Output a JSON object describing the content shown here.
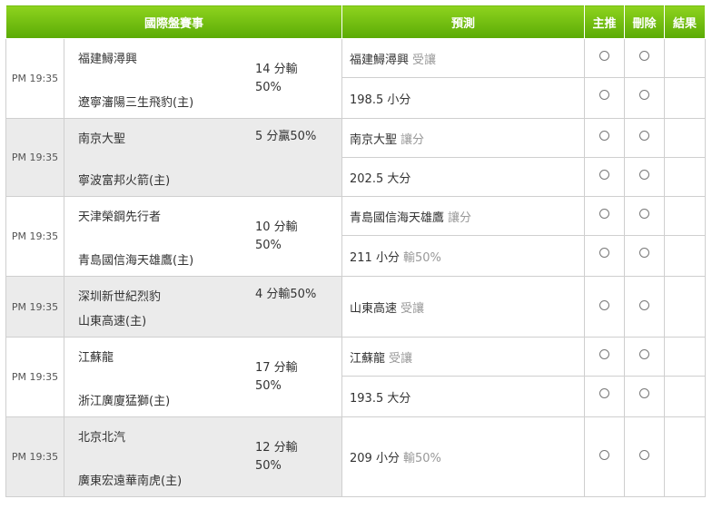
{
  "header": {
    "match": "國際盤賽事",
    "prediction": "預測",
    "main_pick": "主推",
    "delete": "刪除",
    "result": "結果"
  },
  "games": [
    {
      "time": "PM 19:35",
      "home": "福建鱘潯興",
      "away": "遼寧瀋陽三生飛豹(主)",
      "handicap": "14 分輸\n50%",
      "predictions": [
        {
          "main": "福建鱘潯興",
          "sub": "受讓"
        },
        {
          "main": "198.5 小分",
          "sub": ""
        }
      ]
    },
    {
      "time": "PM 19:35",
      "home": "南京大聖",
      "away": "寧波富邦火箭(主)",
      "handicap": "5 分贏50%",
      "predictions": [
        {
          "main": "南京大聖",
          "sub": "讓分"
        },
        {
          "main": "202.5 大分",
          "sub": ""
        }
      ]
    },
    {
      "time": "PM 19:35",
      "home": "天津榮鋼先行者",
      "away": "青島國信海天雄鷹(主)",
      "handicap": "10 分輸\n50%",
      "predictions": [
        {
          "main": "青島國信海天雄鷹",
          "sub": "讓分"
        },
        {
          "main": "211 小分",
          "sub": "輸50%"
        }
      ]
    },
    {
      "time": "PM 19:35",
      "home": "深圳新世紀烈豹",
      "away": "山東高速(主)",
      "handicap": "4 分輸50%",
      "predictions": [
        {
          "main": "山東高速",
          "sub": "受讓"
        }
      ]
    },
    {
      "time": "PM 19:35",
      "home": "江蘇龍",
      "away": "浙江廣廈猛獅(主)",
      "handicap": "17 分輸\n50%",
      "predictions": [
        {
          "main": "江蘇龍",
          "sub": "受讓"
        },
        {
          "main": "193.5 大分",
          "sub": ""
        }
      ]
    },
    {
      "time": "PM 19:35",
      "home": "北京北汽",
      "away": "廣東宏遠華南虎(主)",
      "handicap": "12 分輸\n50%",
      "predictions": [
        {
          "main": "209 小分",
          "sub": "輸50%"
        }
      ]
    }
  ]
}
